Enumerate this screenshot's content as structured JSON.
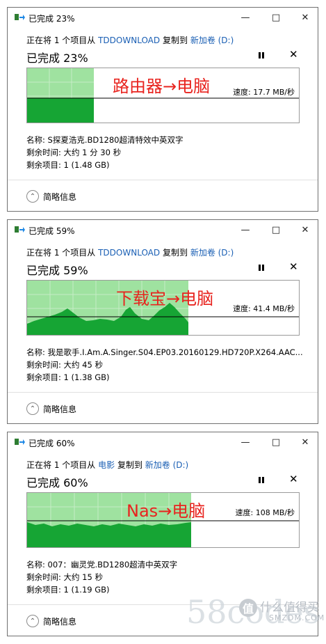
{
  "colors": {
    "fill_light": "#9fe2a0",
    "fill_dark": "#16a534",
    "grid": "#cdeecd",
    "link": "#1a5fb4",
    "overlay": "#e8231e"
  },
  "dialogs": [
    {
      "title": "已完成 23%",
      "line_prefix": "正在将 1 个项目从",
      "source": "TDDOWNLOAD",
      "mid": "复制到",
      "dest": "新加卷 (D:)",
      "percent_text": "已完成 23%",
      "progress": 0.23,
      "overlay": "路由器→电脑",
      "speed": "速度: 17.7 MB/秒",
      "name": "名称: S探夏浩克.BD1280超清特效中英双字",
      "time_left": "剩余时间: 大约 1 分 30 秒",
      "items_left": "剩余项目: 1 (1.48 GB)",
      "details": "简略信息"
    },
    {
      "title": "已完成 59%",
      "line_prefix": "正在将 1 个项目从",
      "source": "TDDOWNLOAD",
      "mid": "复制到",
      "dest": "新加卷 (D:)",
      "percent_text": "已完成 59%",
      "progress": 0.59,
      "overlay": "下载宝→电脑",
      "speed": "速度: 41.4 MB/秒",
      "name": "名称: 我是歌手.I.Am.A.Singer.S04.EP03.20160129.HD720P.X264.AAC...",
      "time_left": "剩余时间: 大约 45 秒",
      "items_left": "剩余项目: 1 (1.38 GB)",
      "details": "简略信息"
    },
    {
      "title": "已完成 60%",
      "line_prefix": "正在将 1 个项目从",
      "source": "电影",
      "mid": "复制到",
      "dest": "新加卷 (D:)",
      "percent_text": "已完成 60%",
      "progress": 0.6,
      "overlay": "Nas→电脑",
      "speed": "速度: 108 MB/秒",
      "name": "名称: 007：幽灵党.BD1280超清中英双字",
      "time_left": "剩余时间: 大约 15 秒",
      "items_left": "剩余项目: 1 (1.19 GB)",
      "details": "简略信息"
    }
  ],
  "watermark": {
    "site": "58codes",
    "brand": "什么值得买",
    "brand_sub": "SMZDM.COM",
    "brand_glyph": "值"
  }
}
